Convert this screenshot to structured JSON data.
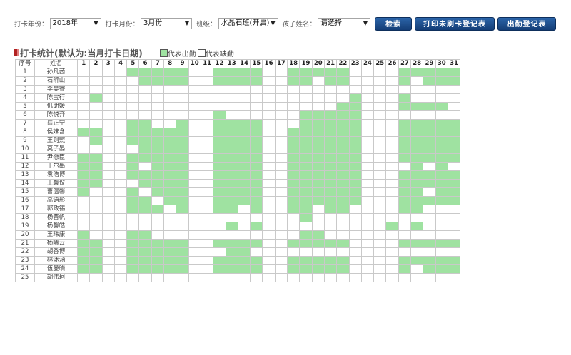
{
  "filters": {
    "year_label": "打卡年份：",
    "year_value": "2018年",
    "month_label": "打卡月份：",
    "month_value": "3月份",
    "class_label": "班级：",
    "class_value": "水晶石班(开启)",
    "child_label": "孩子姓名：",
    "child_value": "请选择",
    "dropdown_icon": "triangle-down-icon"
  },
  "buttons": {
    "search": "检索",
    "print_unpunched": "打印未刷卡登记表",
    "attendance_register": "出勤登记表"
  },
  "colors": {
    "present": "#9fe2a1",
    "absent": "#ffffff",
    "button": "#1f4f8f",
    "title_marker": "#b22222"
  },
  "section": {
    "title": "打卡统计(默认为:当月打卡日期)",
    "legend_present": "代表出勤",
    "legend_absent": "代表缺勤"
  },
  "table": {
    "header_index": "序号",
    "header_name": "姓名",
    "days": [
      "1",
      "2",
      "3",
      "4",
      "5",
      "6",
      "7",
      "8",
      "9",
      "10",
      "11",
      "12",
      "13",
      "14",
      "15",
      "16",
      "17",
      "18",
      "19",
      "20",
      "21",
      "22",
      "23",
      "24",
      "25",
      "26",
      "27",
      "28",
      "29",
      "30",
      "31"
    ],
    "rows": [
      {
        "no": "1",
        "name": "孙凡茜",
        "att": "0000111110011110011111000011111"
      },
      {
        "no": "2",
        "name": "石昕山",
        "att": "0000011110011110011011000010111"
      },
      {
        "no": "3",
        "name": "李昊睿",
        "att": "0000000000000000000000000000000"
      },
      {
        "no": "4",
        "name": "陈宝行",
        "att": "0100000000000000000000100010000"
      },
      {
        "no": "5",
        "name": "仉朗媛",
        "att": "0000000000000000000001100011110"
      },
      {
        "no": "6",
        "name": "陈悦齐",
        "att": "0000000000010000001111100000000"
      },
      {
        "no": "7",
        "name": "岳正宁",
        "att": "0000110010011110001111100011111"
      },
      {
        "no": "8",
        "name": "侯妹含",
        "att": "1100111110011110011111100011111"
      },
      {
        "no": "9",
        "name": "王则熙",
        "att": "0100111110011110011111100011111"
      },
      {
        "no": "10",
        "name": "莫子晏",
        "att": "0000011110011110011111100011111"
      },
      {
        "no": "11",
        "name": "尹懋臣",
        "att": "1100111110011110011111100011111"
      },
      {
        "no": "12",
        "name": "于尔串",
        "att": "1100101110011110011111100001010"
      },
      {
        "no": "13",
        "name": "袁浩博",
        "att": "1100111110011110011111100011111"
      },
      {
        "no": "14",
        "name": "王馨仪",
        "att": "1100011110011110011111100011111"
      },
      {
        "no": "15",
        "name": "曹温馨",
        "att": "1000101110011110011111100011011"
      },
      {
        "no": "16",
        "name": "高语彤",
        "att": "0000110110011110011111100011111"
      },
      {
        "no": "17",
        "name": "郭政锡",
        "att": "0000111010011010011011000011000"
      },
      {
        "no": "18",
        "name": "杨晋帆",
        "att": "0000000000000000001000000000000"
      },
      {
        "no": "19",
        "name": "杨馨皓",
        "att": "0000000000001010000000000101000"
      },
      {
        "no": "20",
        "name": "王玮康",
        "att": "1000110000000000001100000000000"
      },
      {
        "no": "21",
        "name": "杨曦云",
        "att": "1100111110011110011111000011111"
      },
      {
        "no": "22",
        "name": "胡香博",
        "att": "1100111110001100000000000000000"
      },
      {
        "no": "23",
        "name": "林沐涵",
        "att": "1100111110011110011111000011111"
      },
      {
        "no": "24",
        "name": "伍曼晓",
        "att": "1100111110011110011111000010111"
      },
      {
        "no": "25",
        "name": "胡伟珂",
        "att": "0000000000000000000000000000000"
      }
    ]
  }
}
